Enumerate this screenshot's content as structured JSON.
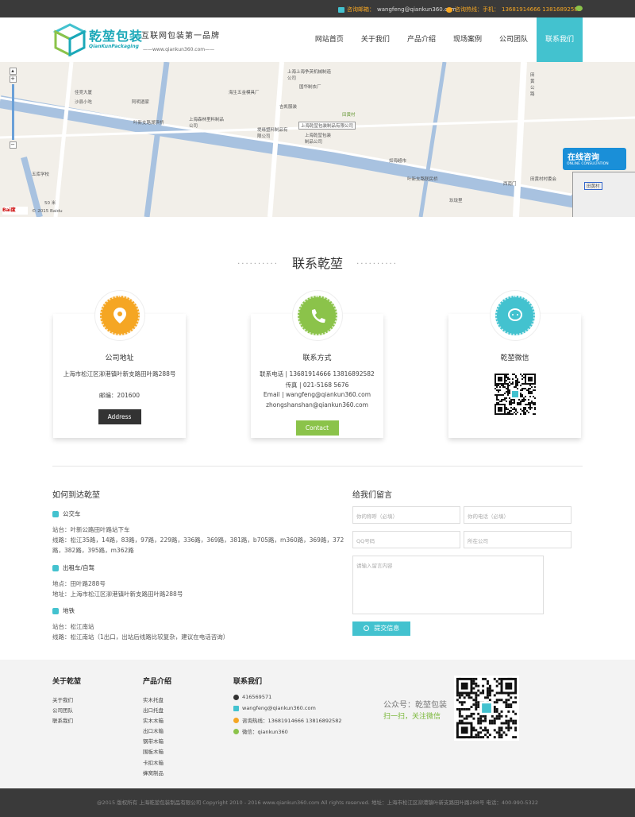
{
  "topbar": {
    "email_label": "咨询邮箱：",
    "email_value": "wangfeng@qiankun360.com",
    "phone_label": "咨询热线：手机：",
    "phone_value": "13681914666 13816892582"
  },
  "header": {
    "logo_cn": "乾堃包装",
    "logo_en": "QianKunPackaging",
    "slogan": "互联网包装第一品牌",
    "url": "——www.qiankun360.com——",
    "nav": [
      "网站首页",
      "关于我们",
      "产品介绍",
      "现场案例",
      "公司团队",
      "联系我们"
    ]
  },
  "map": {
    "labels": [
      "佳竞大厦",
      "沙县小吃",
      "阿明酒家",
      "海生五金模具厂",
      "上海上海争英机械制造公司",
      "国华制衣厂",
      "吉凯服装",
      "上海森林里料制品公司",
      "叶新支路湖滨桥",
      "堤缘塑料制品有限公司",
      "上海乾堃包装制品公司",
      "田黄村",
      "如海超市",
      "叶新支路联民桥",
      "玖珑里",
      "五库学校",
      "西南门",
      "田黄村村委会",
      "田黄公路",
      "50 米",
      "© 2015 Baidu"
    ],
    "marker_label": "上海乾堃包装制品有限公司",
    "online_title": "在线咨询",
    "online_sub": "ONLINE CONSULTATION",
    "minimap_label": "田黄村"
  },
  "section": {
    "title": "联系乾堃",
    "dots": "··········"
  },
  "cards": [
    {
      "title": "公司地址",
      "lines": [
        "上海市松江区泖港镇叶新支路田叶路288号",
        "",
        "邮编：201600"
      ],
      "button": "Address",
      "color": "#f5a623",
      "icon": "location-pin-icon"
    },
    {
      "title": "联系方式",
      "lines": [
        "联系电话 | 13681914666 13816892582",
        "传真 | 021-5168 5676",
        "Email | wangfeng@qiankun360.com",
        "zhongshanshan@qiankun360.com"
      ],
      "button": "Contact",
      "color": "#8bc34a",
      "icon": "phone-icon"
    },
    {
      "title": "乾堃微信",
      "lines": [],
      "button": "",
      "color": "#43c2cf",
      "icon": "wechat-icon"
    }
  ],
  "route": {
    "title": "如何到达乾堃",
    "bus_title": "公交车",
    "bus_stop": "站台：叶新公路田叶路站下车",
    "bus_lines": "线路：松江35路，14路，83路，97路，229路，336路，369路，381路，b705路，m360路，369路，372路，382路，395路，m362路",
    "taxi_title": "出租车/自驾",
    "taxi_place": "地点：田叶路288号",
    "taxi_addr": "地址：上海市松江区泖港镇叶新支路田叶路288号",
    "metro_title": "地铁",
    "metro_stop": "站台：松江南站",
    "metro_line": "线路：松江南站（1出口，出站后线路比较复杂，建议在电话咨询）"
  },
  "message": {
    "title": "给我们留言",
    "name_ph": "你的称呼（必填）",
    "phone_ph": "你的电话（必填）",
    "qq_ph": "QQ号码",
    "company_ph": "所在公司",
    "content_ph": "请输入留言内容",
    "submit": "提交信息"
  },
  "footer": {
    "about_title": "关于乾堃",
    "about_links": [
      "关于我们",
      "公司团队",
      "联系我们"
    ],
    "product_title": "产品介绍",
    "product_links": [
      "实木托盘",
      "出口托盘",
      "实木木箱",
      "出口木箱",
      "钢带木箱",
      "围板木箱",
      "卡扣木箱",
      "蜂窝制品"
    ],
    "contact_title": "联系我们",
    "qq": "416569571",
    "email": "wangfeng@qiankun360.com",
    "hotline": "咨询热线：13681914666 13816892582",
    "wechat": "微信：qiankun360",
    "pub": "公众号：乾堃包装",
    "scan": "扫一扫，关注微信"
  },
  "copyright": "@2015 版权所有 上海乾堃包装制品有限公司 Copyright 2010 - 2016 www.qiankun360.com All rights reserved. 地址：上海市松江区泖港镇叶新支路田叶路288号 电话：400-990-5322"
}
